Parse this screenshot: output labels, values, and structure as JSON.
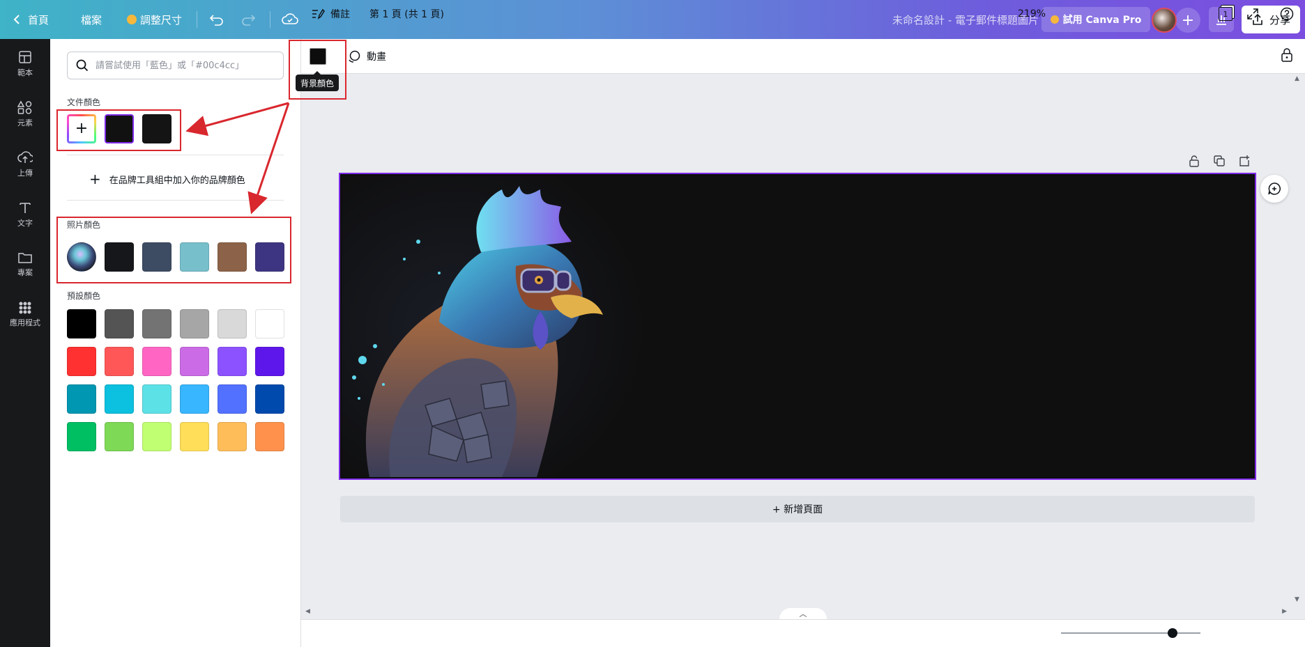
{
  "topbar": {
    "home_label": "首頁",
    "file_label": "檔案",
    "resize_label": "調整尺寸",
    "design_title": "未命名設計 - 電子郵件標題圖片",
    "pro_label": "試用 Canva Pro",
    "share_label": "分享"
  },
  "rail": {
    "items": [
      {
        "label": "範本",
        "icon": "template-icon"
      },
      {
        "label": "元素",
        "icon": "elements-icon"
      },
      {
        "label": "上傳",
        "icon": "upload-icon"
      },
      {
        "label": "文字",
        "icon": "text-icon"
      },
      {
        "label": "專案",
        "icon": "folder-icon"
      },
      {
        "label": "應用程式",
        "icon": "apps-icon"
      }
    ]
  },
  "panel": {
    "search_placeholder": "請嘗試使用「藍色」或「#00c4cc」",
    "document_colors_label": "文件顏色",
    "document_colors": [
      "#111111",
      "#141414"
    ],
    "brand_add_label": "在品牌工具組中加入你的品牌顏色",
    "photo_colors_label": "照片顏色",
    "photo_colors": [
      "#16171a",
      "#3d4c63",
      "#76bfcb",
      "#8c6349",
      "#3e3582"
    ],
    "default_colors_label": "預設顏色",
    "default_colors": [
      [
        "#000000",
        "#545454",
        "#737373",
        "#a6a6a6",
        "#d9d9d9",
        "#ffffff"
      ],
      [
        "#ff3131",
        "#ff5757",
        "#ff66c4",
        "#cb6ce6",
        "#8c52ff",
        "#5e17eb"
      ],
      [
        "#0097b2",
        "#0cc0df",
        "#5ce1e6",
        "#38b6ff",
        "#5271ff",
        "#004aad"
      ],
      [
        "#00bf63",
        "#7ed957",
        "#c1ff72",
        "#ffde59",
        "#ffbd59",
        "#ff914d"
      ]
    ]
  },
  "toolbar": {
    "bg_color_tooltip": "背景顏色",
    "animate_label": "動畫"
  },
  "canvas": {
    "add_page_label": "+ 新增頁面"
  },
  "bottombar": {
    "notes_label": "備註",
    "page_info": "第 1 頁 (共 1 頁)",
    "zoom": "219%",
    "page_count": "1"
  }
}
